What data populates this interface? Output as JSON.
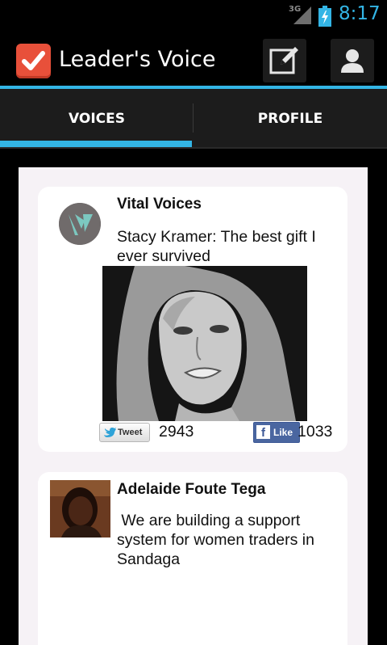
{
  "status_bar": {
    "network": "3G",
    "time": "8:17",
    "accent_color": "#33b5e5"
  },
  "action_bar": {
    "app_title": "Leader's Voice",
    "app_icon": "checkmark-icon",
    "actions": [
      {
        "icon": "compose-icon"
      },
      {
        "icon": "profile-icon"
      }
    ]
  },
  "tabs": [
    {
      "label": "VOICES",
      "selected": true
    },
    {
      "label": "PROFILE",
      "selected": false
    }
  ],
  "feed": [
    {
      "author": "Vital Voices",
      "text": "Stacy Kramer: The best gift I ever survived",
      "tweet_label": "Tweet",
      "tweet_count": "2943",
      "like_label": "Like",
      "like_count": "1033"
    },
    {
      "author": "Adelaide Foute Tega",
      "text": "We are building a support system for women traders in Sandaga"
    }
  ]
}
